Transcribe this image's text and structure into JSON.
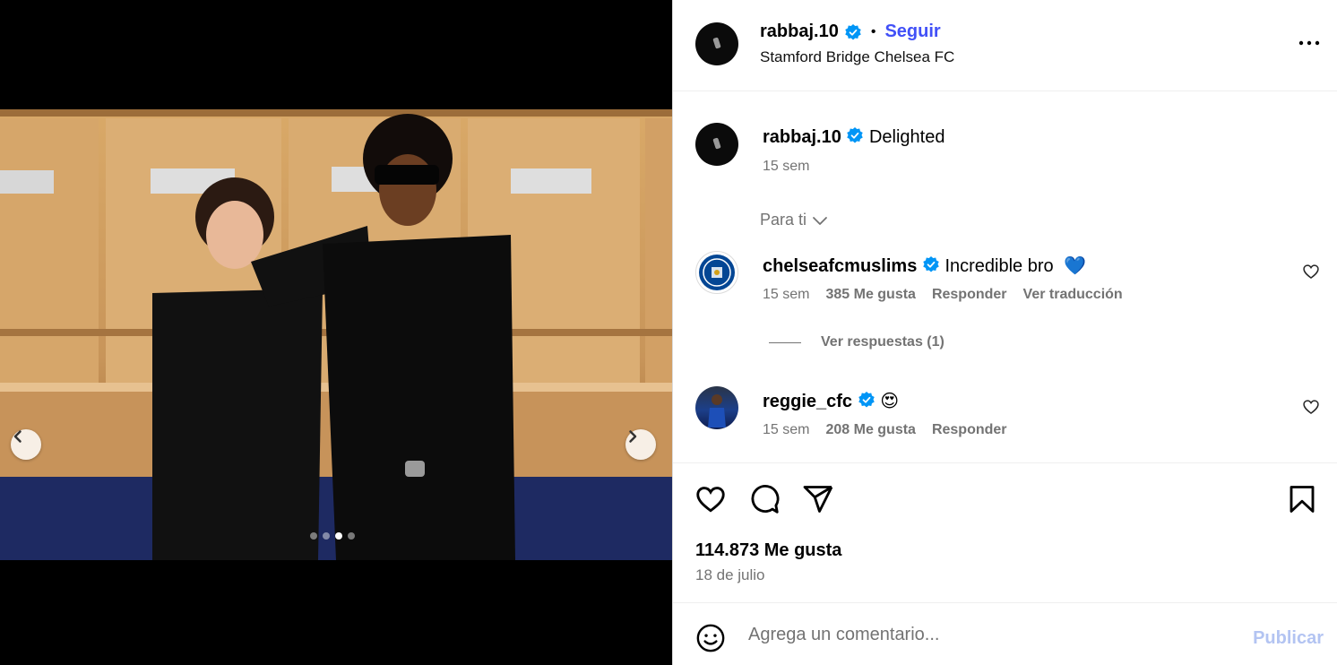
{
  "post": {
    "author": "rabbaj.10",
    "follow_label": "Seguir",
    "bullet": "•",
    "location": "Stamford Bridge Chelsea FC",
    "caption_text": "Delighted",
    "caption_time": "15 sem",
    "image_alt": "Two young men in black suits posing in front of wooden lockers with Chelsea crests",
    "carousel": {
      "total": 4,
      "current_index": 3
    }
  },
  "comments_section": {
    "filter_label": "Para ti",
    "comments": [
      {
        "user": "chelseafcmuslims",
        "text": "Incredible bro",
        "emoji": "💙",
        "time": "15 sem",
        "likes": "385 Me gusta",
        "reply_label": "Responder",
        "translate_label": "Ver traducción",
        "view_replies": "Ver respuestas (1)"
      },
      {
        "user": "reggie_cfc",
        "text": "",
        "emoji": "😍",
        "time": "15 sem",
        "likes": "208 Me gusta",
        "reply_label": "Responder"
      }
    ]
  },
  "engagement": {
    "likes_count": "114.873 Me gusta",
    "date": "18 de julio"
  },
  "comment_box": {
    "placeholder": "Agrega un comentario...",
    "publish_label": "Publicar"
  },
  "colors": {
    "follow": "#4150f7",
    "verified": "#0095f6",
    "secondary_text": "#737373",
    "publish_disabled": "#b3c4f2"
  },
  "icons": [
    "verified-badge-icon",
    "more-options-icon",
    "chevron-down-icon",
    "heart-icon",
    "comment-icon",
    "share-icon",
    "bookmark-icon",
    "emoji-icon",
    "chevron-left-icon",
    "chevron-right-icon"
  ]
}
